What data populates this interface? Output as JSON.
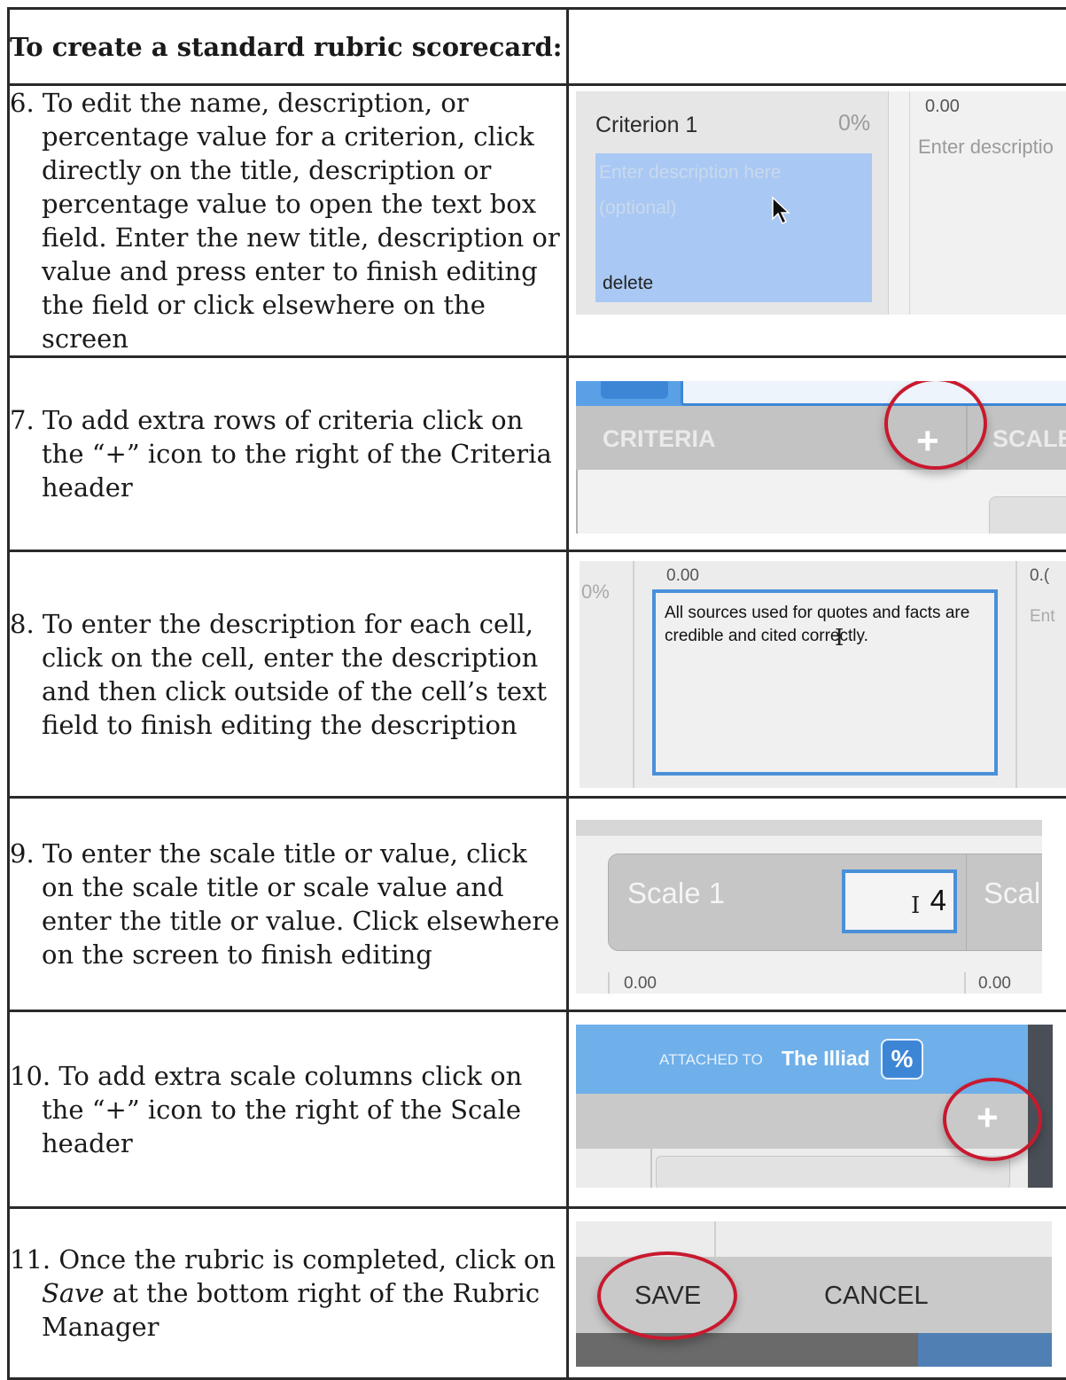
{
  "header": {
    "title": "To create a standard rubric scorecard:"
  },
  "steps": [
    {
      "id": "6",
      "text": "6. To edit the name, description, or percentage value for a criterion, click directly on the title, description or percentage value to open the text box field. Enter the new title, description or value and press enter to finish editing the field or click elsewhere on the screen"
    },
    {
      "id": "7",
      "text": "7. To add extra rows of criteria click on the “+” icon to the right of the Criteria header"
    },
    {
      "id": "8",
      "text": "8. To enter the description for each cell, click on the cell, enter the description and then click outside of the cell’s text field to finish editing the description"
    },
    {
      "id": "9",
      "text": "9. To enter the scale title or value, click on the scale title or scale value and enter the title or value. Click elsewhere on the screen to finish editing"
    },
    {
      "id": "10",
      "text": "10. To add extra scale columns click on the “+” icon to the right of the Scale header"
    },
    {
      "id": "11",
      "before": "11. Once the rubric is completed, click on ",
      "emph": "Save",
      "after": " at the bottom right of the Rubric Manager"
    }
  ],
  "shot6": {
    "criterion_title": "Criterion 1",
    "percent": "0%",
    "placeholder_line1": "Enter description here",
    "placeholder_line2": "(optional)",
    "delete_label": "delete",
    "score": "0.00",
    "placeholder_cut": "Enter descriptio"
  },
  "shot7": {
    "criteria_label": "CRITERIA",
    "scale_label": "SCALE"
  },
  "shot8": {
    "percent": "0%",
    "score1": "0.00",
    "score2": "0.(",
    "cell_text": "All sources used for quotes and facts are credible and cited correctly.",
    "enter_cut": "Ent"
  },
  "shot9": {
    "scale_title": "Scale 1",
    "scale_value": "4",
    "scale_cut": "Scal",
    "score1": "0.00",
    "score2": "0.00"
  },
  "shot10": {
    "attached_prefix": "ATTACHED TO",
    "attached_name": "The Illiad"
  },
  "shot11": {
    "save_label": "SAVE",
    "cancel_label": "CANCEL"
  },
  "colors": {
    "accent_blue": "#4a90d9",
    "highlight_blue": "#a9c8f3",
    "red_ring": "#c8192e",
    "header_blue": "#6fb0ea"
  }
}
